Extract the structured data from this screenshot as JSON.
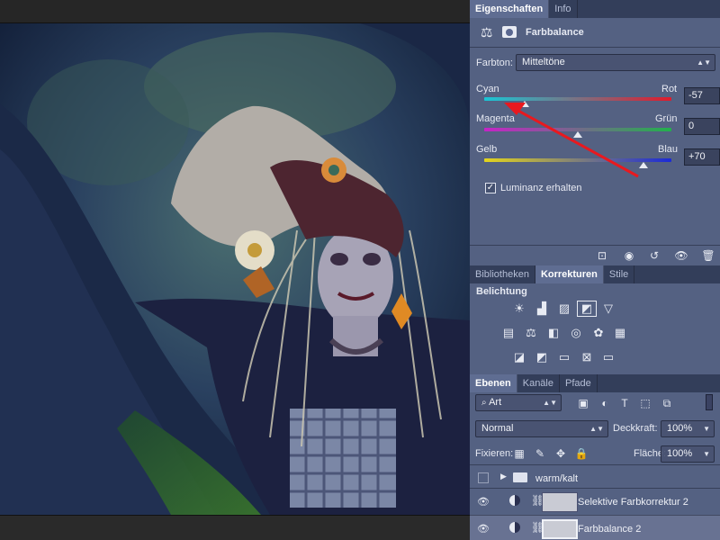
{
  "properties": {
    "tabs": [
      "Eigenschaften",
      "Info"
    ],
    "panel_title": "Farbbalance",
    "tone_label": "Farbton:",
    "tone_value": "Mitteltöne",
    "sliders": [
      {
        "left": "Cyan",
        "right": "Rot",
        "value": "-57",
        "level": -57,
        "colors": [
          "#19c6d6",
          "#e01b2c"
        ]
      },
      {
        "left": "Magenta",
        "right": "Grün",
        "value": "0",
        "level": 0,
        "colors": [
          "#c623c7",
          "#22b14c"
        ]
      },
      {
        "left": "Gelb",
        "right": "Blau",
        "value": "+70",
        "level": 70,
        "colors": [
          "#e3d41c",
          "#1b2ad8"
        ]
      }
    ],
    "luminance_label": "Luminanz erhalten",
    "luminance_checked": true
  },
  "adjustments": {
    "tabs": [
      "Bibliotheken",
      "Korrekturen",
      "Stile"
    ],
    "section_label": "Belichtung"
  },
  "layers": {
    "tabs": [
      "Ebenen",
      "Kanäle",
      "Pfade"
    ],
    "filter_value": "Art",
    "blend_mode": "Normal",
    "opacity_label": "Deckkraft:",
    "opacity_value": "100%",
    "lock_label": "Fixieren:",
    "fill_label": "Fläche:",
    "fill_value": "100%",
    "items": [
      {
        "name": "warm/kalt",
        "type": "group"
      },
      {
        "name": "Selektive Farbkorrektur 2",
        "type": "adjustment"
      },
      {
        "name": "Farbbalance 2",
        "type": "adjustment"
      }
    ]
  },
  "annotation": {
    "color": "#e8191f"
  }
}
